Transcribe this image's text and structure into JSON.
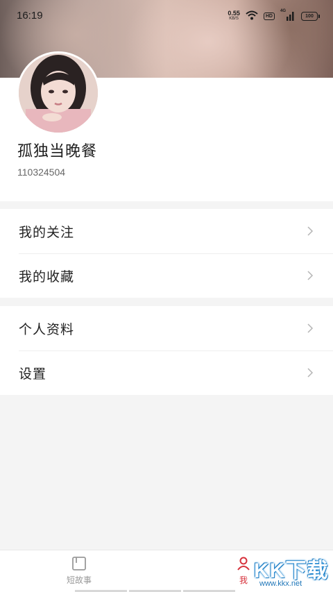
{
  "status_bar": {
    "time": "16:19",
    "net_speed_value": "0.55",
    "net_speed_unit": "KB/S",
    "hd_label": "HD",
    "signal_tag": "4G",
    "battery": "100"
  },
  "profile": {
    "username": "孤独当晚餐",
    "user_id": "110324504"
  },
  "menu": {
    "group1": [
      {
        "label": "我的关注"
      },
      {
        "label": "我的收藏"
      }
    ],
    "group2": [
      {
        "label": "个人资料"
      },
      {
        "label": "设置"
      }
    ]
  },
  "bottom_nav": {
    "stories_label": "短故事",
    "me_label": "我",
    "active_color": "#d6303a",
    "inactive_color": "#999999"
  },
  "watermark": {
    "brand": "KK下载",
    "url": "www.kkx.net"
  }
}
